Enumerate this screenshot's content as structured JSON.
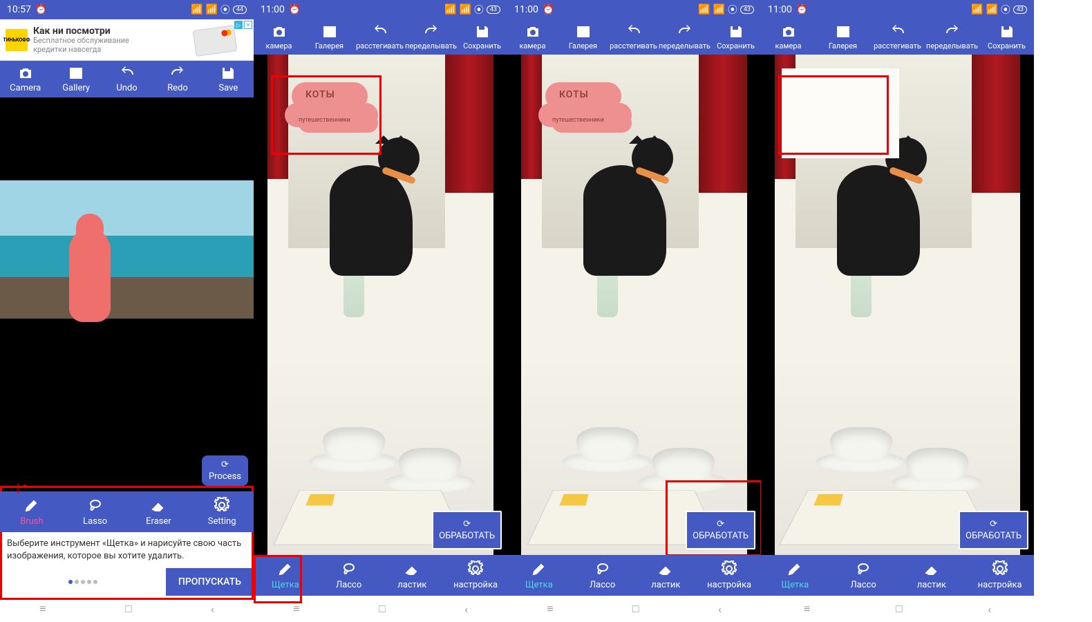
{
  "s1": {
    "time": "10:57",
    "battery": "44",
    "ad": {
      "title": "Как ни посмотри",
      "line1": "Бесплатное обслуживание",
      "line2": "кредитки навсегда",
      "brand": "ТИНЬКОФФ"
    },
    "top": {
      "camera": "Camera",
      "gallery": "Gallery",
      "undo": "Undo",
      "redo": "Redo",
      "save": "Save"
    },
    "process": "Process",
    "bottom": {
      "brush": "Brush",
      "lasso": "Lasso",
      "eraser": "Eraser",
      "setting": "Setting"
    },
    "tutorial": "Выберите инструмент «Щетка» и нарисуйте свою часть изображения, которое вы хотите удалить.",
    "skip": "ПРОПУСКАТЬ"
  },
  "sr": {
    "time": "11:00",
    "battery": "43",
    "top": {
      "camera": "камера",
      "gallery": "Галерея",
      "undo": "расстегивать",
      "redo": "переделывать",
      "save": "Сохранить"
    },
    "watermark": {
      "t1": "КОТЫ",
      "t2": "путешественники"
    },
    "process": "ОБРАБОТАТЬ",
    "bottom": {
      "brush": "Щетка",
      "lasso": "Лассо",
      "eraser": "ластик",
      "setting": "настройка"
    }
  }
}
